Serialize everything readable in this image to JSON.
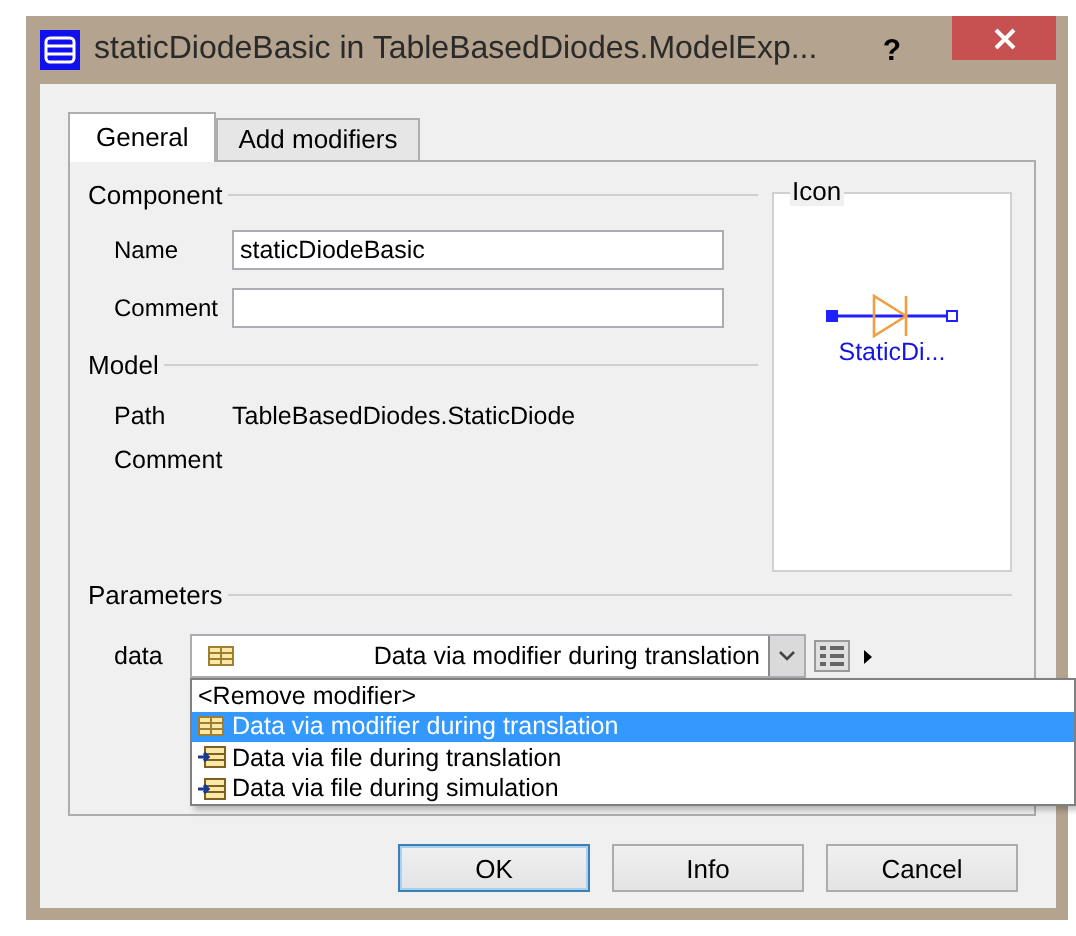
{
  "window": {
    "title": "staticDiodeBasic in TableBasedDiodes.ModelExp...",
    "help": "?"
  },
  "tabs": [
    {
      "label": "General",
      "selected": true
    },
    {
      "label": "Add modifiers",
      "selected": false
    }
  ],
  "component": {
    "title": "Component",
    "fields": [
      {
        "label": "Name",
        "value": "staticDiodeBasic"
      },
      {
        "label": "Comment"
      }
    ]
  },
  "model": {
    "title": "Model",
    "rows": [
      {
        "label": "Path",
        "value": "TableBasedDiodes.StaticDiode"
      },
      {
        "label": "Comment"
      }
    ]
  },
  "icon_panel": {
    "title": "Icon",
    "caption": "StaticDi..."
  },
  "parameters": {
    "title": "Parameters",
    "data": {
      "label": "data",
      "value": "Data via modifier during translation",
      "expanded": true,
      "menu": [
        {
          "label": "<Remove modifier>",
          "kind": "plain",
          "selected": false
        },
        {
          "label": "Data via modifier during translation",
          "kind": "table",
          "selected": true
        },
        {
          "label": "Data via file during translation",
          "kind": "file",
          "selected": false
        },
        {
          "label": "Data via file during simulation",
          "kind": "file",
          "selected": false
        }
      ]
    }
  },
  "buttons": [
    {
      "label": "OK",
      "default": true
    },
    {
      "label": "Info",
      "default": false
    },
    {
      "label": "Cancel",
      "default": false
    }
  ]
}
